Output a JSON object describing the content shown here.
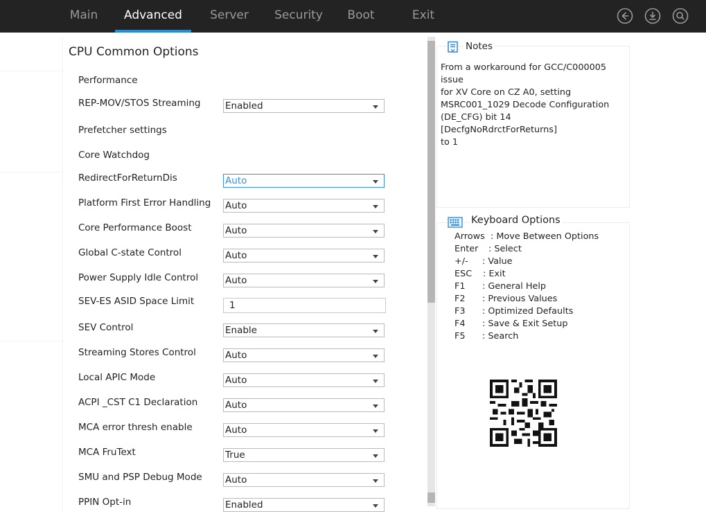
{
  "nav": {
    "tabs": [
      {
        "label": "Main"
      },
      {
        "label": "Advanced"
      },
      {
        "label": "Server"
      },
      {
        "label": "Security"
      },
      {
        "label": "Boot"
      },
      {
        "label": "Exit"
      }
    ],
    "active_tab": "Advanced",
    "icons": [
      "back-icon",
      "download-icon",
      "search-icon"
    ]
  },
  "panel": {
    "title": "CPU Common Options",
    "rows": [
      {
        "label": "Performance"
      },
      {
        "label": "REP-MOV/STOS Streaming",
        "value": "Enabled"
      },
      {
        "label": "Prefetcher settings"
      },
      {
        "label": "Core Watchdog"
      },
      {
        "label": "RedirectForReturnDis",
        "value": "Auto"
      },
      {
        "label": "Platform First Error Handling",
        "value": "Auto"
      },
      {
        "label": "Core Performance Boost",
        "value": "Auto"
      },
      {
        "label": "Global C-state Control",
        "value": "Auto"
      },
      {
        "label": "Power Supply Idle Control",
        "value": "Auto"
      },
      {
        "label": "SEV-ES ASID Space Limit",
        "value": "1"
      },
      {
        "label": "SEV Control",
        "value": "Enable"
      },
      {
        "label": "Streaming Stores Control",
        "value": "Auto"
      },
      {
        "label": "Local APIC Mode",
        "value": "Auto"
      },
      {
        "label": "ACPI _CST C1 Declaration",
        "value": "Auto"
      },
      {
        "label": "MCA error thresh enable",
        "value": "Auto"
      },
      {
        "label": "MCA FruText",
        "value": "True"
      },
      {
        "label": "SMU and PSP Debug Mode",
        "value": "Auto"
      },
      {
        "label": "PPIN Opt-in",
        "value": "Enabled"
      }
    ]
  },
  "notes": {
    "title": "Notes",
    "lines": [
      "From a workaround for GCC/C000005 issue",
      "for XV Core on CZ A0, setting",
      "MSRC001_1029 Decode Configuration",
      "(DE_CFG) bit 14 [DecfgNoRdrctForReturns]",
      "to 1"
    ]
  },
  "keyboard": {
    "title": "Keyboard Options",
    "items": [
      {
        "key": "Arrows",
        "desc": ": Move Between Options"
      },
      {
        "key": "Enter",
        "desc": ": Select"
      },
      {
        "key": "+/-",
        "desc": ": Value"
      },
      {
        "key": "ESC",
        "desc": ": Exit"
      },
      {
        "key": "F1",
        "desc": ": General Help"
      },
      {
        "key": "F2",
        "desc": ": Previous Values"
      },
      {
        "key": "F3",
        "desc": ": Optimized Defaults"
      },
      {
        "key": "F4",
        "desc": ": Save & Exit Setup"
      },
      {
        "key": "F5",
        "desc": ": Search"
      }
    ]
  },
  "colors": {
    "topbar": "#232323",
    "accent": "#1a8fe6",
    "focus_border": "#3b8fd9"
  }
}
